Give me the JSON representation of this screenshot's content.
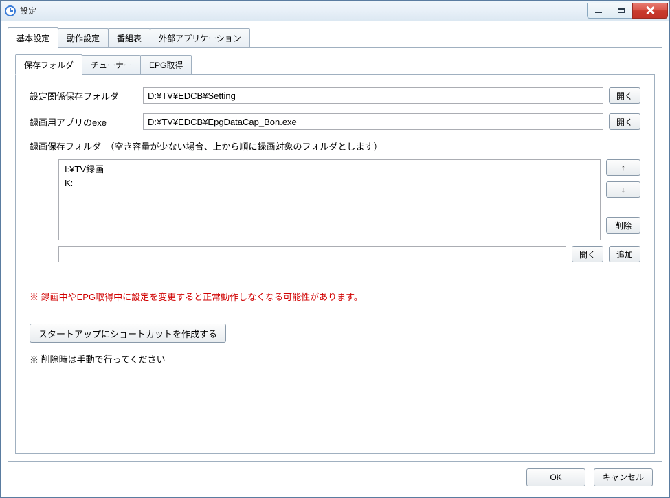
{
  "window": {
    "title": "設定"
  },
  "tabs_primary": [
    {
      "label": "基本設定",
      "active": true
    },
    {
      "label": "動作設定",
      "active": false
    },
    {
      "label": "番組表",
      "active": false
    },
    {
      "label": "外部アプリケーション",
      "active": false
    }
  ],
  "tabs_secondary": [
    {
      "label": "保存フォルダ",
      "active": true
    },
    {
      "label": "チューナー",
      "active": false
    },
    {
      "label": "EPG取得",
      "active": false
    }
  ],
  "form": {
    "settings_folder_label": "設定関係保存フォルダ",
    "settings_folder_value": "D:¥TV¥EDCB¥Setting",
    "rec_app_label": "録画用アプリのexe",
    "rec_app_value": "D:¥TV¥EDCB¥EpgDataCap_Bon.exe",
    "rec_folder_label": "録画保存フォルダ　（空き容量が少ない場合、上から順に録画対象のフォルダとします）",
    "rec_folder_items": [
      "I:¥TV録画",
      "K:"
    ],
    "new_folder_value": ""
  },
  "buttons": {
    "open": "開く",
    "up": "↑",
    "down": "↓",
    "delete": "削除",
    "add": "追加",
    "startup": "スタートアップにショートカットを作成する",
    "ok": "OK",
    "cancel": "キャンセル"
  },
  "messages": {
    "warning": "※ 録画中やEPG取得中に設定を変更すると正常動作しなくなる可能性があります。",
    "note": "※ 削除時は手動で行ってください"
  }
}
